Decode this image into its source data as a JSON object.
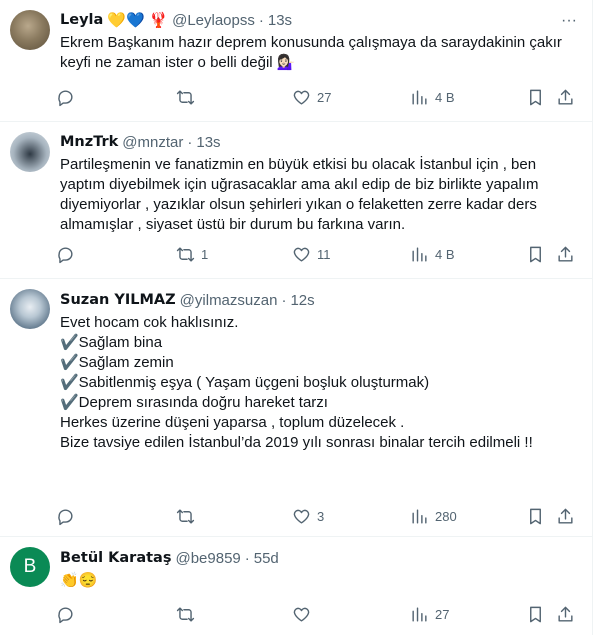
{
  "tweets": [
    {
      "name": "Leyla",
      "emoji": "💛💙 🦞",
      "handle": "@Leylaopss",
      "time": "13s",
      "lines": [
        "Ekrem Başkanım hazır deprem konusunda çalışmaya da saraydakinin çakır",
        "keyfi ne zaman ister o belli değil 💁🏻‍♀️"
      ],
      "replies": "",
      "retweets": "",
      "likes": "27",
      "views": "4 B"
    },
    {
      "name": "MnzTrk",
      "emoji": "",
      "handle": "@mnztar",
      "time": "13s",
      "lines": [
        "Partileşmenin ve fanatizmin en büyük etkisi bu olacak İstanbul için , ben",
        "yaptım diyebilmek için uğrasacaklar ama akıl edip de biz birlikte yapalım",
        "diyemiyorlar , yazıklar olsun şehirleri yıkan o felaketten zerre kadar ders",
        "almamışlar , siyaset üstü bir durum bu farkına varın."
      ],
      "replies": "",
      "retweets": "1",
      "likes": "11",
      "views": "4 B"
    },
    {
      "name": "Suzan YILMAZ",
      "emoji": "",
      "handle": "@yilmazsuzan",
      "time": "12s",
      "lines": [
        "Evet hocam cok haklısınız.",
        "✔️Sağlam bina",
        "✔️Sağlam zemin",
        "✔️Sabitlenmiş eşya ( Yaşam üçgeni boşluk oluşturmak)",
        "✔️Deprem sırasında doğru hareket tarzı",
        "",
        "Herkes üzerine düşeni yaparsa , toplum düzelecek .",
        "",
        "Bize tavsiye edilen İstanbul’da 2019 yılı sonrası binalar tercih edilmeli !!"
      ],
      "replies": "",
      "retweets": "",
      "likes": "3",
      "views": "280"
    },
    {
      "name": "Betül Karataş",
      "emoji": "",
      "handle": "@be9859",
      "time": "55d",
      "avatar_letter": "B",
      "lines": [
        "👏😔"
      ],
      "replies": "",
      "retweets": "",
      "likes": "",
      "views": "27"
    }
  ],
  "icons": {
    "reply": "reply-icon",
    "retweet": "retweet-icon",
    "like": "like-icon",
    "views": "views-icon",
    "bookmark": "bookmark-icon",
    "share": "share-icon",
    "more": "more-icon"
  },
  "separator": "·",
  "more_glyph": "···"
}
